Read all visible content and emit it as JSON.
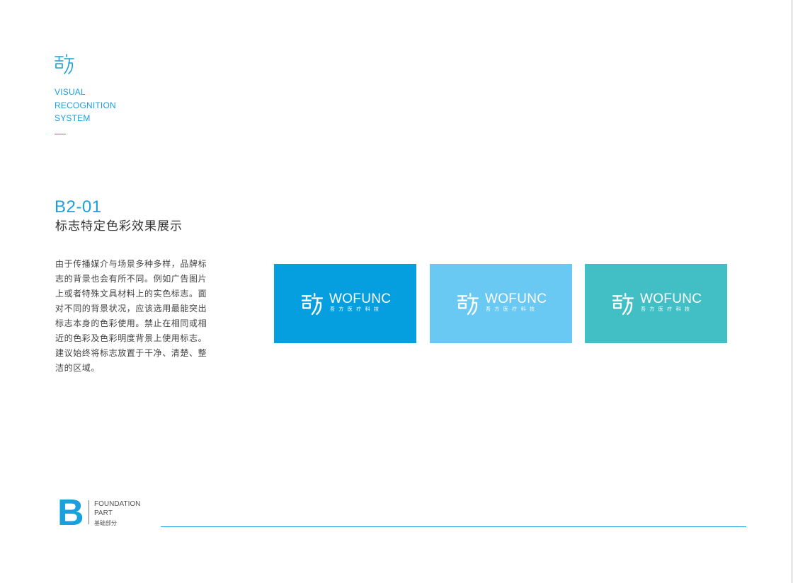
{
  "header": {
    "logo_icon": "wofunc-symbol-icon",
    "accent_color": "#1aa0dc",
    "vis_lines": [
      "VISUAL",
      "RECOGNITION",
      "SYSTEM"
    ]
  },
  "section": {
    "code": "B2-01",
    "title": "标志特定色彩效果展示",
    "description": "由于传播媒介与场景多种多样，品牌标志的背景也会有所不同。例如广告图片上或者特殊文具材料上的实色标志。面对不同的背景状况，应该选用最能突出标志本身的色彩使用。禁止在相同或相近的色彩及色彩明度背景上使用标志。建议始终将标志放置于干净、清楚、整洁的区域。"
  },
  "swatches": [
    {
      "color": "#059fe0",
      "logo_word": "WOFUNC",
      "logo_cn": "吾方医疗科技"
    },
    {
      "color": "#69c9f2",
      "logo_word": "WOFUNC",
      "logo_cn": "吾方医疗科技"
    },
    {
      "color": "#42bfc5",
      "logo_word": "WOFUNC",
      "logo_cn": "吾方医疗科技"
    }
  ],
  "footer": {
    "letter": "B",
    "line1": "FOUNDATION",
    "line2": "PART",
    "cn": "基础部分"
  }
}
